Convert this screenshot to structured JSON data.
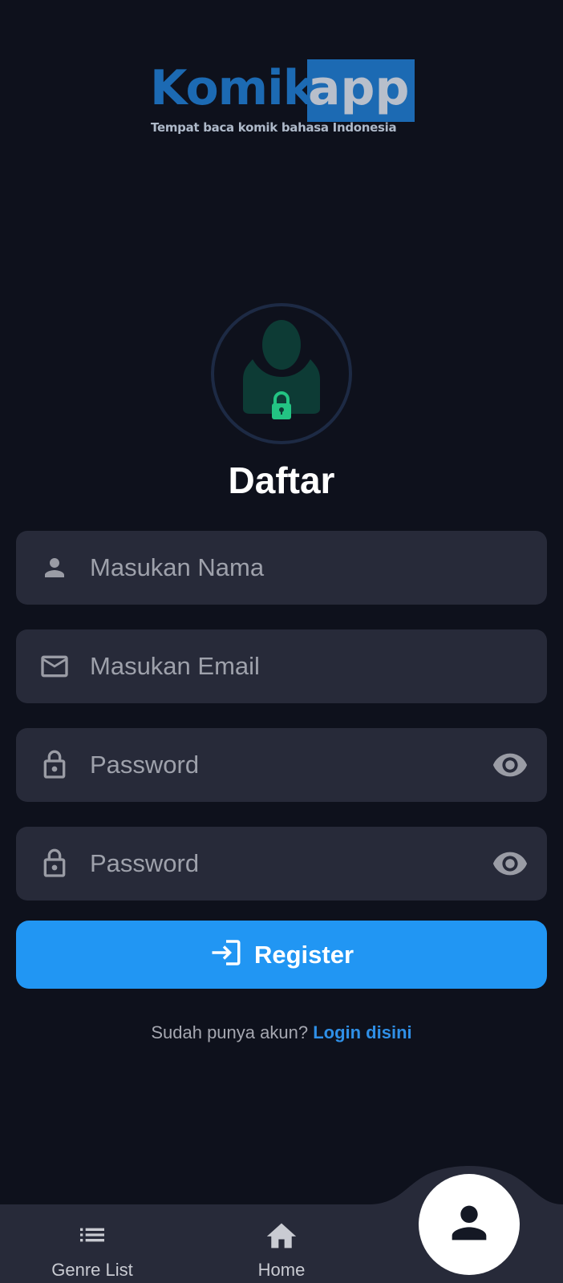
{
  "logo": {
    "komik": "Komik",
    "app": "app",
    "tagline": "Tempat baca komik bahasa Indonesia"
  },
  "title": "Daftar",
  "form": {
    "name_placeholder": "Masukan Nama",
    "email_placeholder": "Masukan Email",
    "password_placeholder": "Password",
    "confirm_password_placeholder": "Password"
  },
  "register_label": "Register",
  "login_prompt": {
    "text": "Sudah punya akun?",
    "link": "Login disini"
  },
  "bottom_nav": {
    "genre_label": "Genre List",
    "home_label": "Home"
  },
  "colors": {
    "background": "#0e111c",
    "field": "#272a39",
    "accent": "#2196f3",
    "link": "#2f8fe6",
    "avatar_green": "#0d3b35",
    "lock_green": "#23c483"
  },
  "icons": [
    "person-icon",
    "mail-icon",
    "lock-icon",
    "eye-icon",
    "login-icon",
    "list-icon",
    "home-icon",
    "profile-icon"
  ]
}
